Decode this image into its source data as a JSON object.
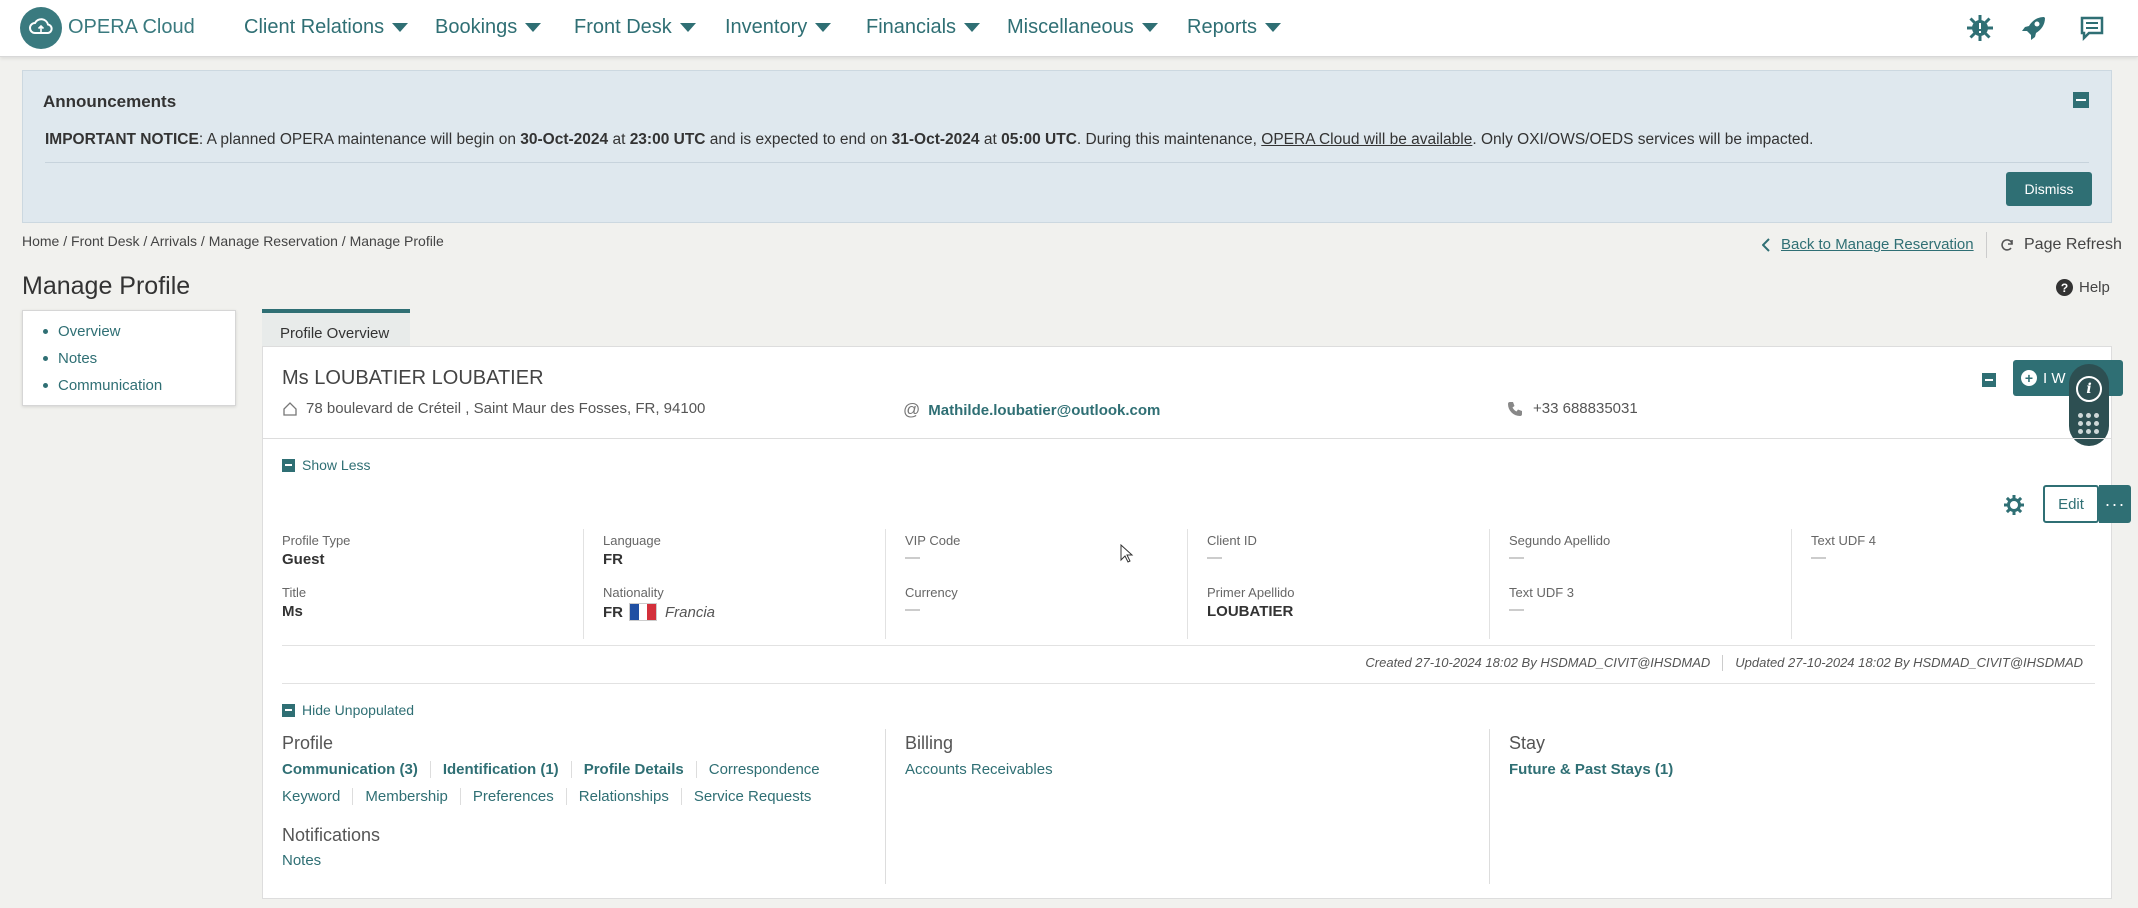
{
  "app": {
    "title": "OPERA Cloud"
  },
  "nav": {
    "items": [
      {
        "label": "Client Relations"
      },
      {
        "label": "Bookings"
      },
      {
        "label": "Front Desk"
      },
      {
        "label": "Inventory"
      },
      {
        "label": "Financials"
      },
      {
        "label": "Miscellaneous"
      },
      {
        "label": "Reports"
      }
    ],
    "icons": [
      "virus-alert-icon",
      "rocket-icon",
      "chat-icon"
    ]
  },
  "announcements": {
    "title": "Announcements",
    "notice_label": "IMPORTANT NOTICE",
    "t1": ": A planned OPERA maintenance will begin on ",
    "start_date": "30-Oct-2024",
    "t2": " at ",
    "start_time": "23:00 UTC",
    "t3": " and is expected to end on ",
    "end_date": "31-Oct-2024",
    "t4": " at ",
    "end_time": "05:00 UTC",
    "t5": ". During this maintenance, ",
    "link": "OPERA Cloud will be available",
    "t6": ". Only OXI/OWS/OEDS services will be impacted.",
    "dismiss": "Dismiss"
  },
  "breadcrumb": "Home / Front Desk / Arrivals / Manage Reservation / Manage Profile",
  "back_link": "Back to Manage Reservation",
  "page_refresh": "Page Refresh",
  "page_title": "Manage Profile",
  "help": "Help",
  "sidenav": [
    "Overview",
    "Notes",
    "Communication"
  ],
  "tab": "Profile Overview",
  "profile": {
    "name": "Ms LOUBATIER LOUBATIER",
    "address": "78 boulevard de Créteil , Saint Maur des Fosses, FR, 94100",
    "email": "Mathilde.loubatier@outlook.com",
    "phone": "+33 688835031",
    "iw_label": "I W"
  },
  "show_less": "Show Less",
  "edit": "Edit",
  "fields": {
    "profile_type": {
      "label": "Profile Type",
      "value": "Guest"
    },
    "title": {
      "label": "Title",
      "value": "Ms"
    },
    "language": {
      "label": "Language",
      "value": "FR"
    },
    "nationality": {
      "label": "Nationality",
      "value": "FR",
      "country": "Francia"
    },
    "vip_code": {
      "label": "VIP Code",
      "value": "—"
    },
    "currency": {
      "label": "Currency",
      "value": "—"
    },
    "client_id": {
      "label": "Client ID",
      "value": "—"
    },
    "primer_apellido": {
      "label": "Primer Apellido",
      "value": "LOUBATIER"
    },
    "segundo_apellido": {
      "label": "Segundo Apellido",
      "value": "—"
    },
    "text_udf3": {
      "label": "Text UDF 3",
      "value": "—"
    },
    "text_udf4": {
      "label": "Text UDF 4",
      "value": "—"
    }
  },
  "meta": {
    "created": "Created  27-10-2024 18:02  By  HSDMAD_CIVIT@IHSDMAD",
    "updated": "Updated  27-10-2024 18:02  By  HSDMAD_CIVIT@IHSDMAD"
  },
  "hide_unpopulated": "Hide Unpopulated",
  "sections": {
    "profile": {
      "title": "Profile",
      "row1": [
        "Communication (3)",
        "Identification (1)",
        "Profile Details",
        "Correspondence"
      ],
      "row2": [
        "Keyword",
        "Membership",
        "Preferences",
        "Relationships",
        "Service Requests"
      ]
    },
    "notifications": {
      "title": "Notifications",
      "link": "Notes"
    },
    "billing": {
      "title": "Billing",
      "link": "Accounts Receivables"
    },
    "stay": {
      "title": "Stay",
      "link": "Future & Past Stays (1)"
    }
  },
  "colors": {
    "accent": "#2f6f74",
    "announce_bg": "#dfe8ee",
    "page_bg": "#f1f1ee"
  }
}
